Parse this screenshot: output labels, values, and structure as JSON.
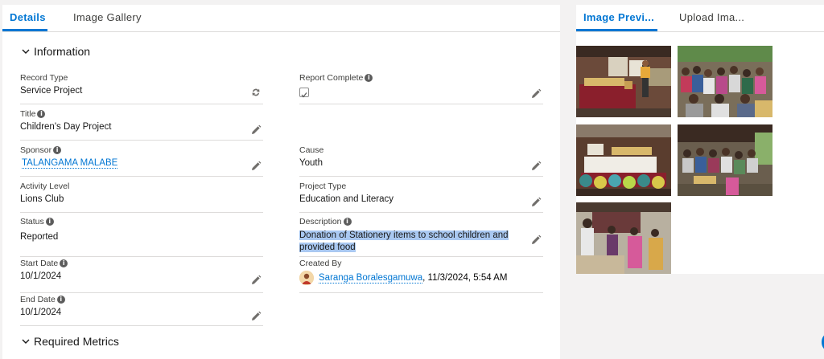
{
  "left_tabs": {
    "details": "Details",
    "gallery": "Image Gallery"
  },
  "right_tabs": {
    "preview": "Image Previ...",
    "upload": "Upload Ima..."
  },
  "sections": {
    "information": "Information",
    "required_metrics": "Required Metrics"
  },
  "fields": {
    "record_type": {
      "label": "Record Type",
      "value": "Service Project"
    },
    "report_complete": {
      "label": "Report Complete",
      "value": true
    },
    "title": {
      "label": "Title",
      "value": "Children's Day Project"
    },
    "sponsor": {
      "label": "Sponsor",
      "value": "TALANGAMA MALABE"
    },
    "cause": {
      "label": "Cause",
      "value": "Youth"
    },
    "activity_level": {
      "label": "Activity Level",
      "value": "Lions Club"
    },
    "project_type": {
      "label": "Project Type",
      "value": "Education and Literacy"
    },
    "status": {
      "label": "Status",
      "value": "Reported"
    },
    "description": {
      "label": "Description",
      "line1": "Donation of Stationery items to school children and",
      "line2": "provided food"
    },
    "start_date": {
      "label": "Start Date",
      "value": "10/1/2024"
    },
    "created_by": {
      "label": "Created By",
      "user": "Saranga Boralesgamuwa",
      "date": ", 11/3/2024, 5:54 AM"
    },
    "end_date": {
      "label": "End Date",
      "value": "10/1/2024"
    }
  },
  "icons": {
    "info": "i"
  },
  "colors": {
    "accent": "#0176d3",
    "highlight": "#a9c8f1",
    "divider": "#dddbda"
  }
}
